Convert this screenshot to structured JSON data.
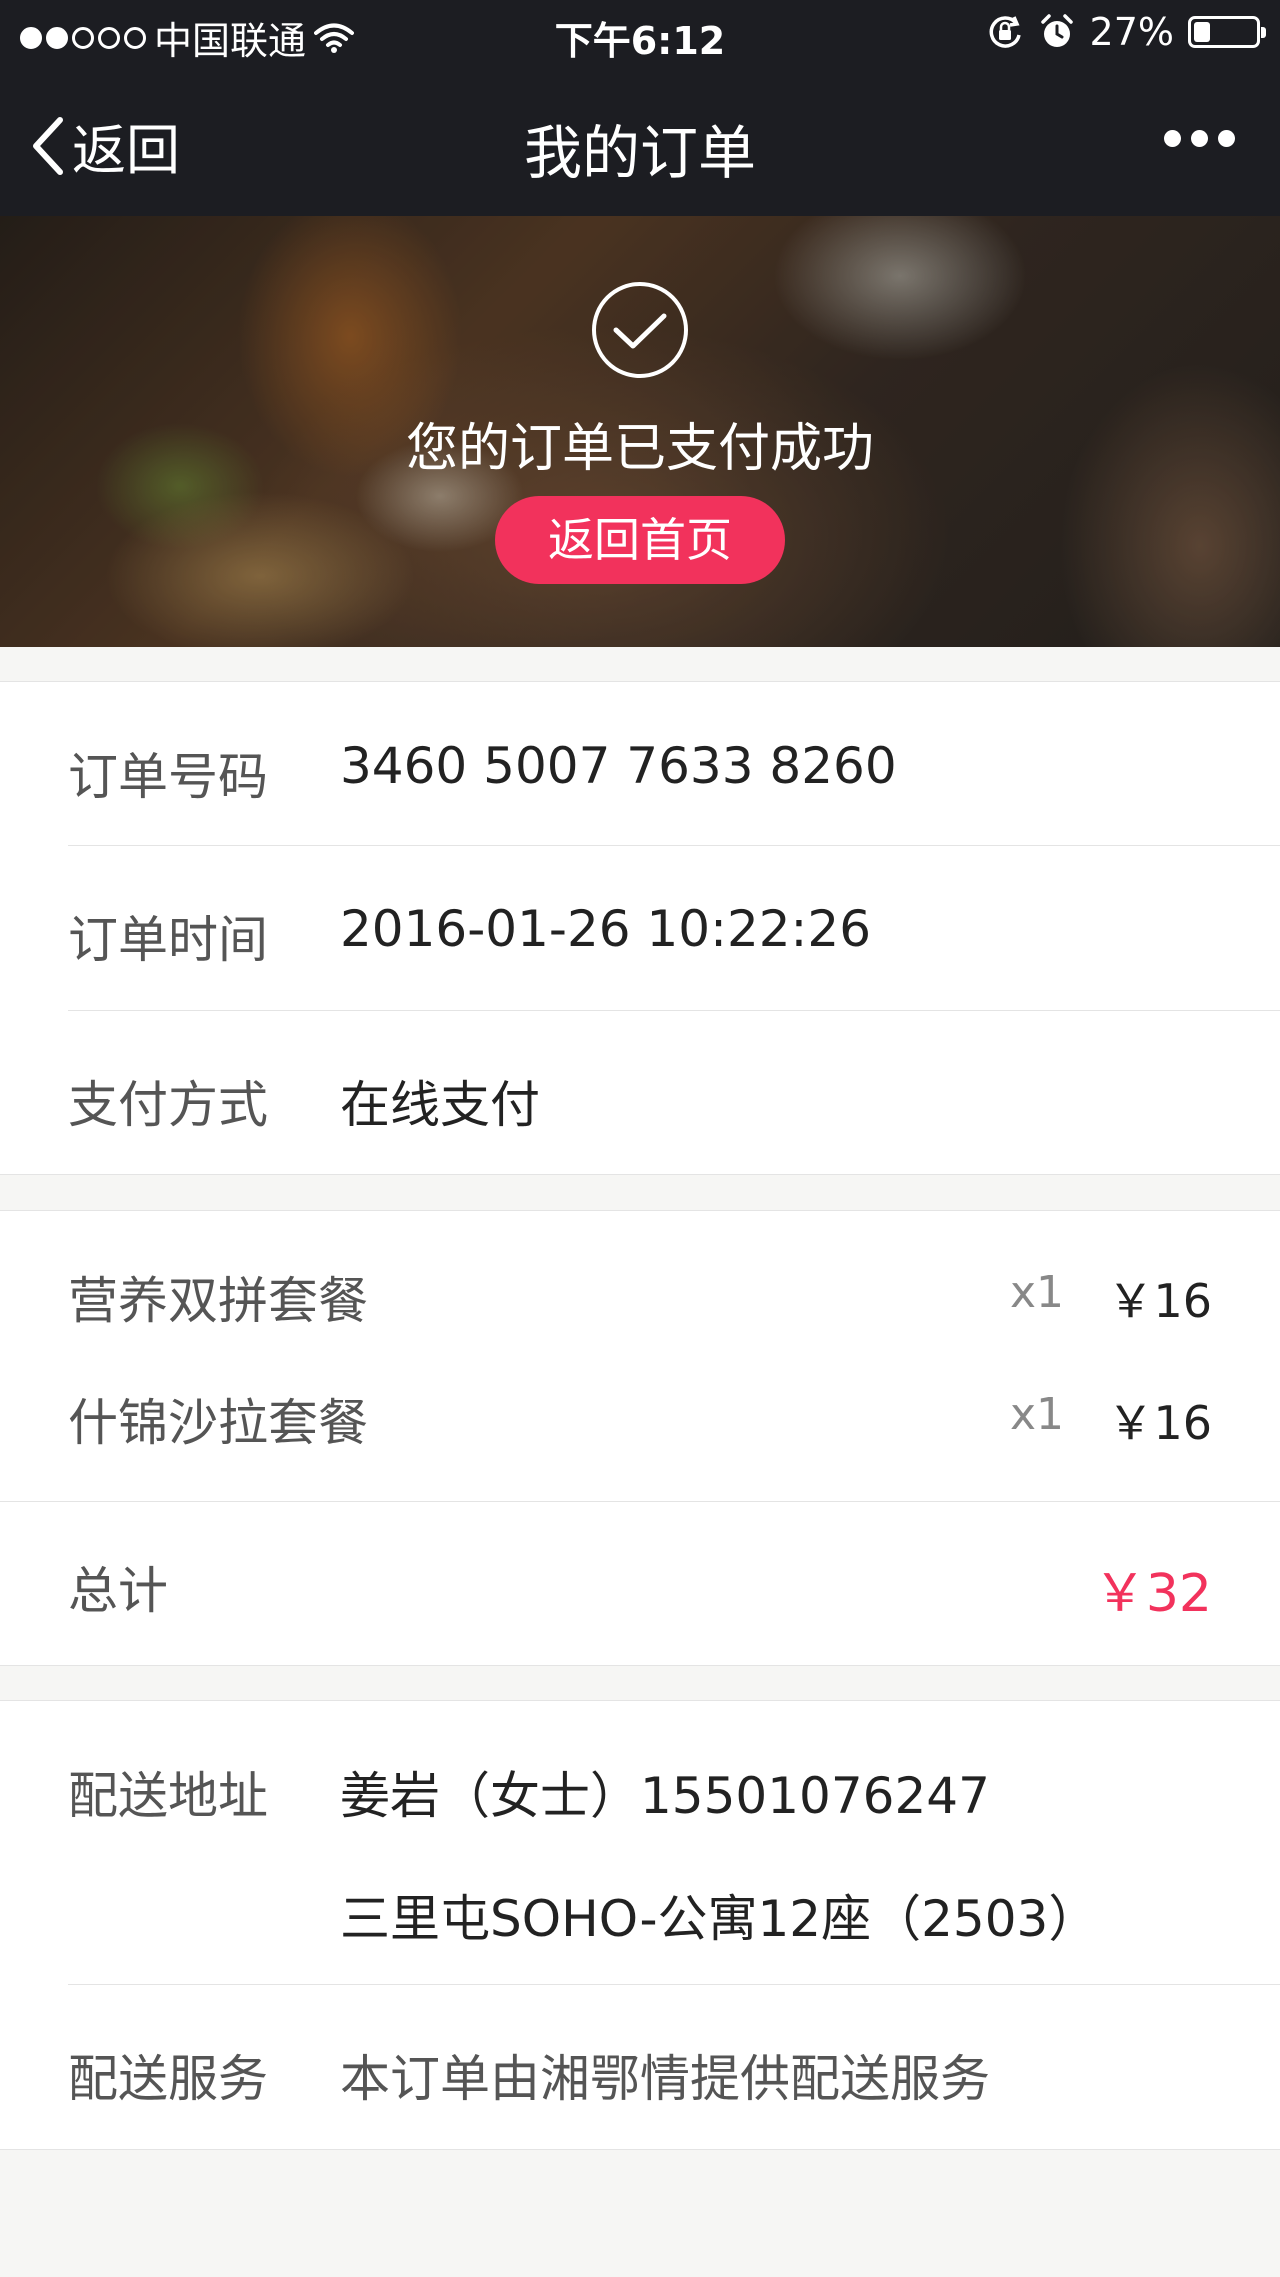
{
  "status_bar": {
    "carrier": "中国联通",
    "time": "下午6:12",
    "battery": "27%",
    "battery_level": 0.27
  },
  "nav": {
    "back_label": "返回",
    "title": "我的订单"
  },
  "hero": {
    "message": "您的订单已支付成功",
    "button_label": "返回首页"
  },
  "order_info": {
    "number_label": "订单号码",
    "number_value": "3460 5007 7633 8260",
    "time_label": "订单时间",
    "time_value": "2016-01-26 10:22:26",
    "payment_label": "支付方式",
    "payment_value": "在线支付"
  },
  "items": [
    {
      "name": "营养双拼套餐",
      "qty": "x1",
      "price": "￥16"
    },
    {
      "name": "什锦沙拉套餐",
      "qty": "x1",
      "price": "￥16"
    }
  ],
  "total": {
    "label": "总计",
    "value": "￥32"
  },
  "delivery": {
    "address_label": "配送地址",
    "address_line1": "姜岩（女士）15501076247",
    "address_line2": "三里屯SOHO-公寓12座（2503）",
    "service_label": "配送服务",
    "service_value": "本订单由湘鄂情提供配送服务"
  },
  "colors": {
    "accent": "#f2325c",
    "navbar": "#1c1d22",
    "background": "#f6f6f4"
  }
}
